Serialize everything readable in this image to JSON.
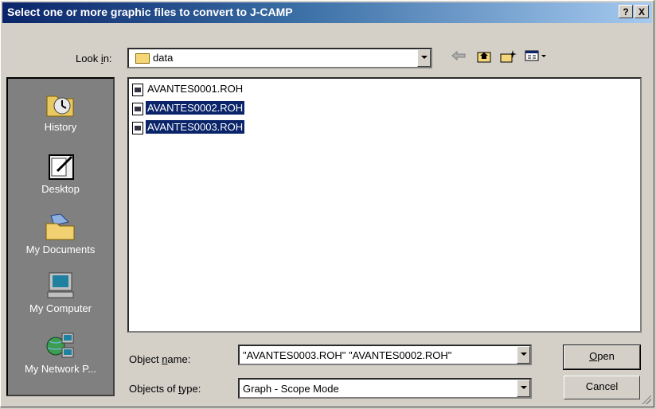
{
  "window": {
    "title": "Select one or more graphic files to convert to J-CAMP",
    "help_button": "?",
    "close_button": "X"
  },
  "look_in": {
    "label_pre": "Look ",
    "label_accel": "i",
    "label_post": "n:",
    "value": "data"
  },
  "toolbar": {
    "back_icon": "back-arrow-icon",
    "up_icon": "up-folder-icon",
    "new_folder_icon": "new-folder-icon",
    "view_menu_icon": "view-menu-icon"
  },
  "places": [
    {
      "label": "History",
      "icon": "history-icon"
    },
    {
      "label": "Desktop",
      "icon": "desktop-icon"
    },
    {
      "label": "My Documents",
      "icon": "my-documents-icon"
    },
    {
      "label": "My Computer",
      "icon": "my-computer-icon"
    },
    {
      "label": "My Network P...",
      "icon": "my-network-icon"
    }
  ],
  "files": [
    {
      "name": "AVANTES0001.ROH",
      "selected": false
    },
    {
      "name": "AVANTES0002.ROH",
      "selected": true
    },
    {
      "name": "AVANTES0003.ROH",
      "selected": true
    }
  ],
  "object_name": {
    "label_pre": "Object ",
    "label_accel": "n",
    "label_post": "ame:",
    "value": "\"AVANTES0003.ROH\" \"AVANTES0002.ROH\""
  },
  "objects_of_type": {
    "label_pre": "Objects of ",
    "label_accel": "t",
    "label_post": "ype:",
    "value": "Graph - Scope Mode"
  },
  "buttons": {
    "open_accel": "O",
    "open_rest": "pen",
    "cancel": "Cancel"
  }
}
